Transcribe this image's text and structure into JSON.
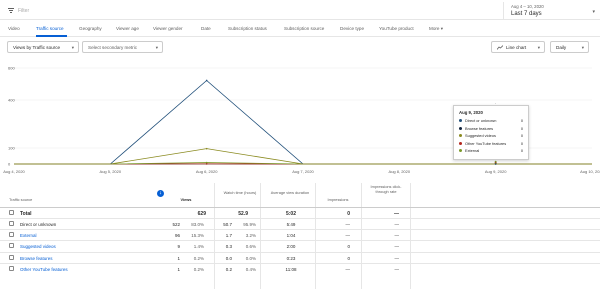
{
  "filter": {
    "placeholder": "Filter"
  },
  "date_range": {
    "range": "Aug 4 – 10, 2020",
    "period": "Last 7 days"
  },
  "tabs": [
    {
      "label": "Video",
      "active": false
    },
    {
      "label": "Traffic source",
      "active": true
    },
    {
      "label": "Geography",
      "active": false
    },
    {
      "label": "Viewer age",
      "active": false
    },
    {
      "label": "Viewer gender",
      "active": false
    },
    {
      "label": "Date",
      "active": false
    },
    {
      "label": "Subscription status",
      "active": false
    },
    {
      "label": "Subscription source",
      "active": false
    },
    {
      "label": "Device type",
      "active": false
    },
    {
      "label": "YouTube product",
      "active": false
    },
    {
      "label": "More",
      "active": false
    }
  ],
  "controls": {
    "metric": "Views by Traffic source",
    "secondary": "Select secondary metric",
    "chart_type": "Line chart",
    "interval": "Daily"
  },
  "chart_data": {
    "type": "line",
    "x": [
      "Aug 4, 2020",
      "Aug 5, 2020",
      "Aug 6, 2020",
      "Aug 7, 2020",
      "Aug 8, 2020",
      "Aug 9, 2020",
      "Aug 10, 2020"
    ],
    "yticks": [
      0,
      100,
      400,
      600
    ],
    "ylim": [
      0,
      600
    ],
    "series": [
      {
        "name": "Direct or unknown",
        "color": "#1f4e79",
        "values": [
          0,
          0,
          522,
          0,
          0,
          0,
          0
        ]
      },
      {
        "name": "Browse features",
        "color": "#12233d",
        "values": [
          0,
          0,
          1,
          0,
          0,
          0,
          0
        ]
      },
      {
        "name": "Suggested videos",
        "color": "#8a8a1f",
        "values": [
          0,
          0,
          96,
          0,
          0,
          0,
          0
        ]
      },
      {
        "name": "Other YouTube features",
        "color": "#b3261e",
        "values": [
          0,
          0,
          1,
          0,
          0,
          0,
          0
        ]
      },
      {
        "name": "External",
        "color": "#7a9a2a",
        "values": [
          0,
          0,
          9,
          0,
          0,
          0,
          0
        ]
      }
    ]
  },
  "tooltip": {
    "title": "Aug 9, 2020",
    "rows": [
      {
        "label": "Direct or unknown",
        "value": "0",
        "color": "#1f4e79"
      },
      {
        "label": "Browse features",
        "value": "0",
        "color": "#12233d"
      },
      {
        "label": "Suggested videos",
        "value": "0",
        "color": "#8a8a1f"
      },
      {
        "label": "Other YouTube features",
        "value": "0",
        "color": "#b3261e"
      },
      {
        "label": "External",
        "value": "0",
        "color": "#7a9a2a"
      }
    ]
  },
  "table": {
    "headers": {
      "source": "Traffic source",
      "views": "Views",
      "watch_time": "Watch time (hours)",
      "avg_duration": "Average view duration",
      "impressions": "Impressions",
      "ctr": "Impressions click-through rate"
    },
    "total": {
      "label": "Total",
      "views": "629",
      "watch_time": "52.9",
      "avg_duration": "5:02",
      "impressions": "0",
      "ctr": "—"
    },
    "rows": [
      {
        "label": "Direct or unknown",
        "link": false,
        "views": "522",
        "views_pct": "83.0%",
        "watch": "50.7",
        "watch_pct": "95.9%",
        "avg": "5:49",
        "impr": "—",
        "ctr": "—"
      },
      {
        "label": "External",
        "link": true,
        "views": "96",
        "views_pct": "15.3%",
        "watch": "1.7",
        "watch_pct": "3.2%",
        "avg": "1:04",
        "impr": "—",
        "ctr": "—"
      },
      {
        "label": "Suggested videos",
        "link": true,
        "views": "9",
        "views_pct": "1.4%",
        "watch": "0.3",
        "watch_pct": "0.6%",
        "avg": "2:00",
        "impr": "0",
        "ctr": "—"
      },
      {
        "label": "Browse features",
        "link": true,
        "views": "1",
        "views_pct": "0.2%",
        "watch": "0.0",
        "watch_pct": "0.0%",
        "avg": "0:23",
        "impr": "0",
        "ctr": "—"
      },
      {
        "label": "Other YouTube features",
        "link": true,
        "views": "1",
        "views_pct": "0.2%",
        "watch": "0.2",
        "watch_pct": "0.4%",
        "avg": "11:08",
        "impr": "—",
        "ctr": "—"
      }
    ]
  }
}
